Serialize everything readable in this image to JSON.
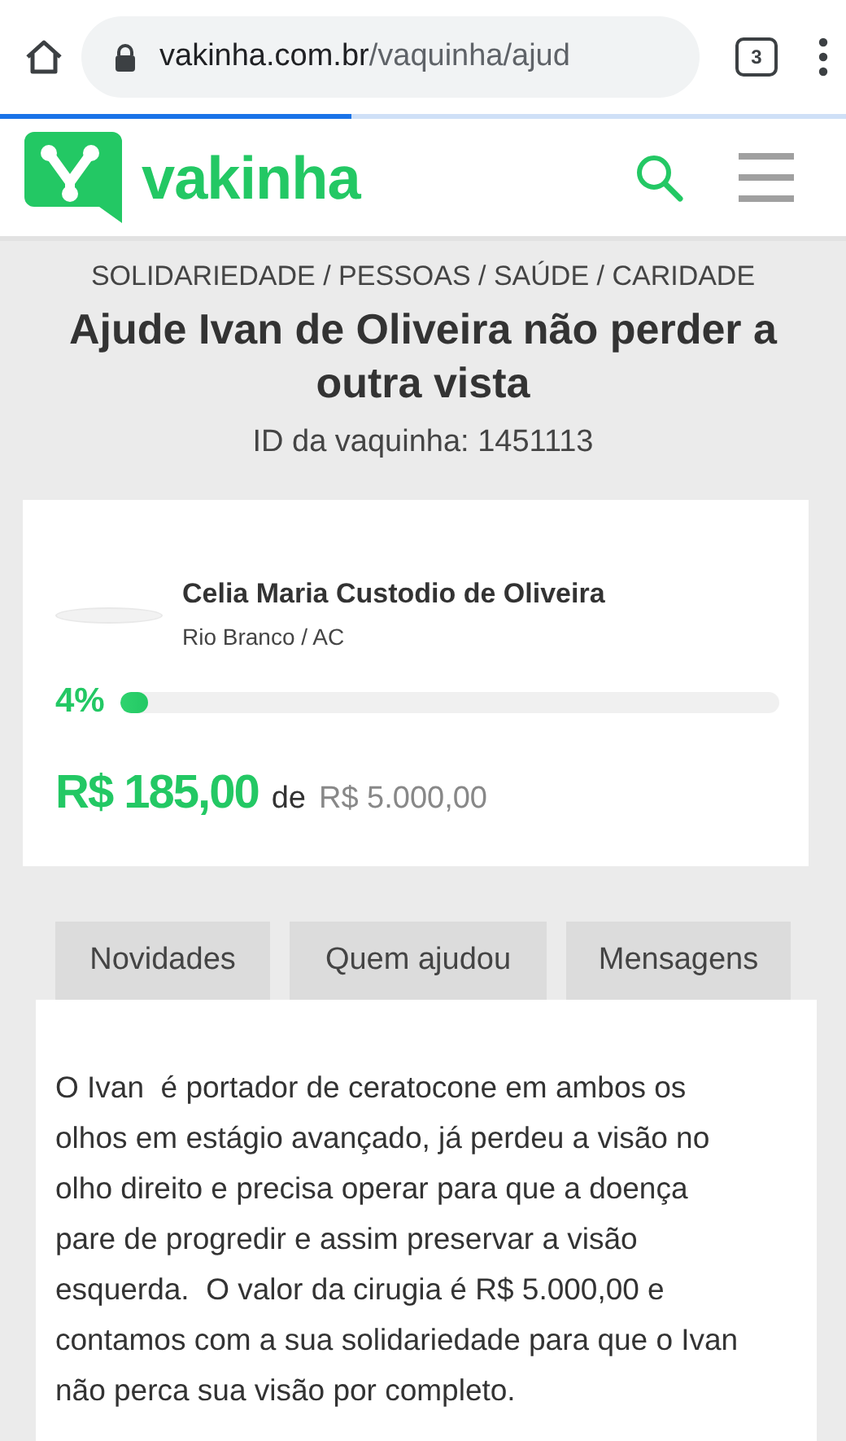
{
  "browser": {
    "domain": "vakinha.com.br",
    "path": "/vaquinha/ajud",
    "tab_count": "3",
    "loading": {
      "level": 0.415
    }
  },
  "site": {
    "logo_text": "vakinha"
  },
  "campaign": {
    "breadcrumb": "SOLIDARIEDADE / PESSOAS / SAÚDE / CARIDADE",
    "title": "Ajude Ivan de Oliveira não perder a outra vista",
    "id_text": "ID da vaquinha: 1451113",
    "organizer": {
      "name": "Celia Maria Custodio de Oliveira",
      "location": "Rio Branco / AC"
    },
    "progress": {
      "percent": "4%",
      "level": 0.04
    },
    "raised": "R$ 185,00",
    "of": "de",
    "goal": "R$ 5.000,00"
  },
  "tabs": [
    {
      "label": "Novidades",
      "selected": false
    },
    {
      "label": "Quem ajudou",
      "selected": false
    },
    {
      "label": "Mensagens",
      "selected": false
    }
  ],
  "description": "O Ivan  é portador de ceratocone em ambos os olhos em estágio avançado, já perdeu a visão no olho direito e precisa operar para que a doença pare de progredir e assim preservar a visão esquerda.  O valor da cirugia é R$ 5.000,00 e contamos com a sua solidariedade para que o Ivan não perca sua visão por completo."
}
